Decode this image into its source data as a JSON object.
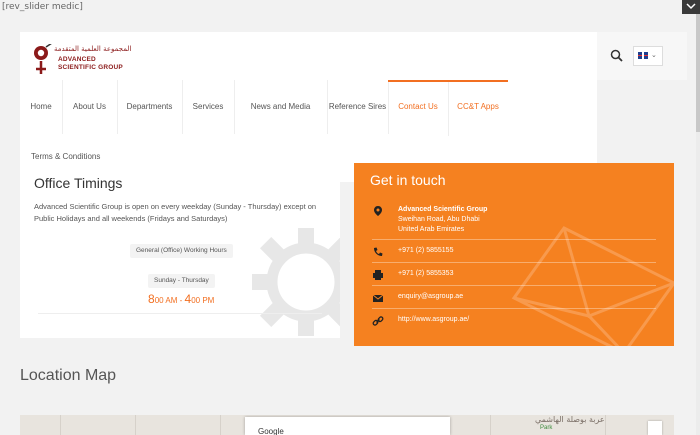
{
  "shortcode_text": "[rev_slider medic]",
  "logo": {
    "arabic": "المجموعة العلمية المتقدمة",
    "line1": "ADVANCED",
    "line2": "SCIENTIFIC GROUP"
  },
  "nav": {
    "items": [
      {
        "label": "Home"
      },
      {
        "label": "About Us"
      },
      {
        "label": "Departments"
      },
      {
        "label": "Services"
      },
      {
        "label": "News and Media"
      },
      {
        "label": "Reference Sires"
      },
      {
        "label": "Contact Us"
      },
      {
        "label": "CC&T Apps"
      }
    ],
    "terms_label": "Terms & Conditions"
  },
  "icons": {
    "search": "search-icon",
    "language": "uk-flag-icon",
    "chevron": "chevron-down-icon",
    "corner": "chevron-down-icon"
  },
  "timings": {
    "title": "Office Timings",
    "description": "Advanced Scientific Group is open on every weekday (Sunday - Thursday) except on Public Holidays and all weekends (Fridays and Saturdays)",
    "badge_label": "General (Office) Working Hours",
    "days": "Sunday - Thursday",
    "open_hour": "8",
    "open_suffix": "00 AM",
    "dash": "-",
    "close_hour": "4",
    "close_suffix": "00 PM"
  },
  "contact": {
    "title": "Get in touch",
    "company": "Advanced Scientific Group",
    "address1": "Sweihan Road, Abu Dhabi",
    "address2": "United Arab Emirates",
    "phone": "+971 (2) 5855155",
    "fax": "+971 (2) 5855353",
    "email": "enquiry@asgroup.ae",
    "website": "http://www.asgroup.ae/"
  },
  "location": {
    "title": "Location Map",
    "map_brand": "Google",
    "map_label": "عربة بوصلة الهاشمي",
    "map_park": "Park"
  },
  "colors": {
    "accent": "#f26f21",
    "contact_bg": "#f58120",
    "brand": "#8b1a1a"
  }
}
